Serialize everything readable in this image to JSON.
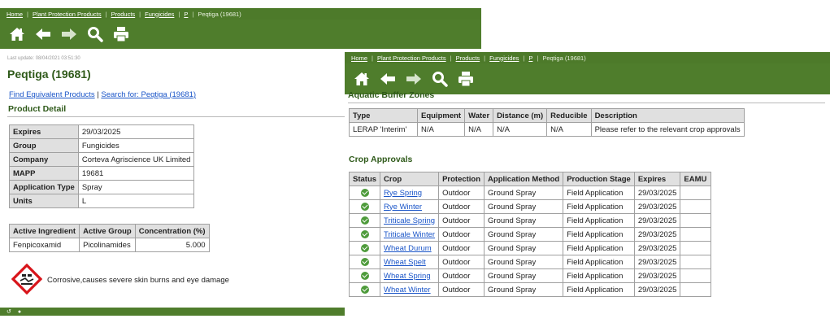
{
  "left": {
    "breadcrumb": [
      "Home",
      "Plant Protection Products",
      "Products",
      "Fungicides",
      "P",
      "Peqtiga (19681)"
    ],
    "last_update": "Last update: 08/04/2021 03:51:30",
    "title": "Peqtiga (19681)",
    "links": {
      "find_equivalent": "Find Equivalent Products",
      "separator": "|",
      "search_for": "Search for: Peqtiga (19681)"
    },
    "product_detail": {
      "heading": "Product Detail",
      "rows": [
        {
          "label": "Expires",
          "value": "29/03/2025"
        },
        {
          "label": "Group",
          "value": "Fungicides"
        },
        {
          "label": "Company",
          "value": "Corteva Agriscience UK Limited"
        },
        {
          "label": "MAPP",
          "value": "19681"
        },
        {
          "label": "Application Type",
          "value": "Spray"
        },
        {
          "label": "Units",
          "value": "L"
        }
      ]
    },
    "ingredients": {
      "headers": [
        "Active Ingredient",
        "Active Group",
        "Concentration (%)"
      ],
      "rows": [
        [
          "Fenpicoxamid",
          "Picolinamides",
          "5.000"
        ]
      ]
    },
    "hazard_text": "Corrosive,causes severe skin burns and eye damage"
  },
  "right": {
    "breadcrumb": [
      "Home",
      "Plant Protection Products",
      "Products",
      "Fungicides",
      "P",
      "Peqtiga (19681)"
    ],
    "aquatic": {
      "heading": "Aquatic Buffer Zones",
      "headers": [
        "Type",
        "Equipment",
        "Water",
        "Distance (m)",
        "Reducible",
        "Description"
      ],
      "rows": [
        [
          "LERAP 'Interim'",
          "N/A",
          "N/A",
          "N/A",
          "N/A",
          "Please refer to the relevant crop approvals"
        ]
      ]
    },
    "crop_approvals": {
      "heading": "Crop Approvals",
      "headers": [
        "Status",
        "Crop",
        "Protection",
        "Application Method",
        "Production Stage",
        "Expires",
        "EAMU"
      ],
      "rows": [
        [
          "Rye Spring",
          "Outdoor",
          "Ground Spray",
          "Field Application",
          "29/03/2025",
          ""
        ],
        [
          "Rye Winter",
          "Outdoor",
          "Ground Spray",
          "Field Application",
          "29/03/2025",
          ""
        ],
        [
          "Triticale Spring",
          "Outdoor",
          "Ground Spray",
          "Field Application",
          "29/03/2025",
          ""
        ],
        [
          "Triticale Winter",
          "Outdoor",
          "Ground Spray",
          "Field Application",
          "29/03/2025",
          ""
        ],
        [
          "Wheat Durum",
          "Outdoor",
          "Ground Spray",
          "Field Application",
          "29/03/2025",
          ""
        ],
        [
          "Wheat Spelt",
          "Outdoor",
          "Ground Spray",
          "Field Application",
          "29/03/2025",
          ""
        ],
        [
          "Wheat Spring",
          "Outdoor",
          "Ground Spray",
          "Field Application",
          "29/03/2025",
          ""
        ],
        [
          "Wheat Winter",
          "Outdoor",
          "Ground Spray",
          "Field Application",
          "29/03/2025",
          ""
        ]
      ]
    }
  },
  "toolbar_icons": [
    "home-icon",
    "back-arrow-icon",
    "forward-arrow-icon",
    "search-icon",
    "print-icon"
  ],
  "colors": {
    "header_green": "#4f7d2c",
    "title_green": "#2f5a1a",
    "link_blue": "#1a55c8",
    "status_green": "#4e9b3b"
  }
}
